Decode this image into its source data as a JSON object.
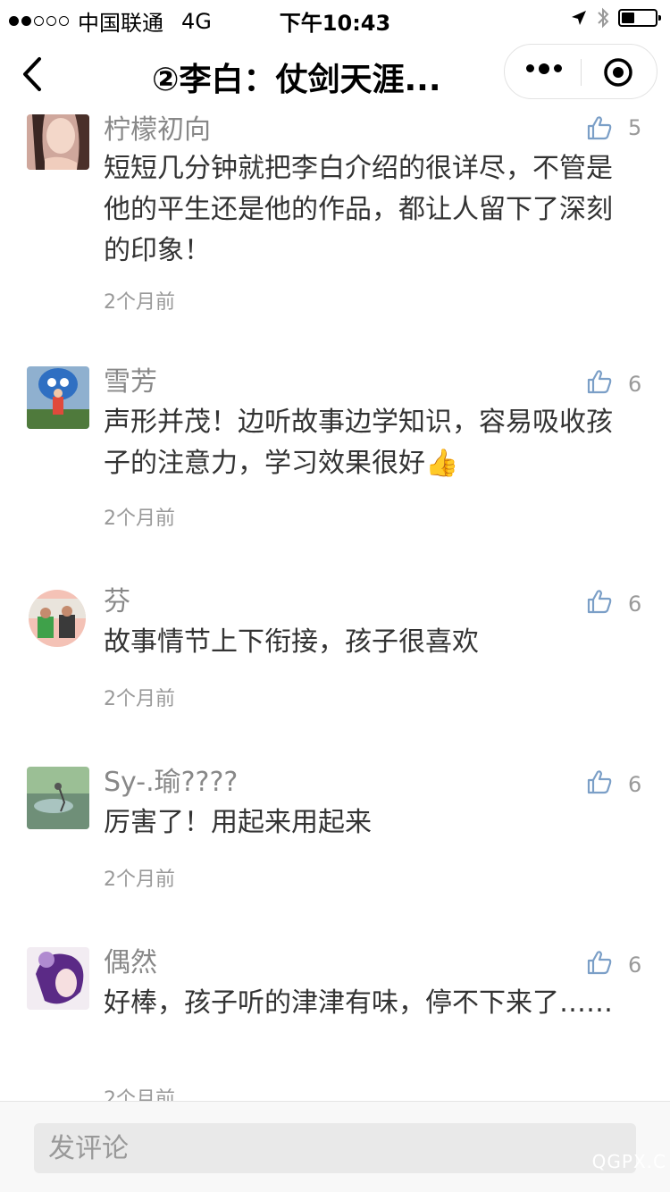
{
  "status": {
    "carrier": "中国联通",
    "network": "4G",
    "time": "下午10:43"
  },
  "nav": {
    "title": "②李白：仗剑天涯..."
  },
  "comments": [
    {
      "name": "柠檬初向",
      "text": "短短几分钟就把李白介绍的很详尽，不管是他的平生还是他的作品，都让人留下了深刻的印象！",
      "time": "2个月前",
      "likes": "5"
    },
    {
      "name": "雪芳",
      "text": "声形并茂！边听故事边学知识，容易吸收孩子的注意力，学习效果很好👍",
      "time": "2个月前",
      "likes": "6"
    },
    {
      "name": "芬",
      "text": "故事情节上下衔接，孩子很喜欢",
      "time": "2个月前",
      "likes": "6"
    },
    {
      "name": "Sy-.瑜????",
      "text": "厉害了！用起来用起来",
      "time": "2个月前",
      "likes": "6"
    },
    {
      "name": "偶然",
      "text": "好棒，孩子听的津津有味，停不下来了……",
      "time": "2个月前",
      "likes": "6"
    }
  ],
  "bottom": {
    "placeholder": "发评论"
  },
  "watermark": "QGPX.C",
  "colors": {
    "like_icon": "#7b9fc7",
    "meta_text": "#999999",
    "input_bg": "#e9e9e9"
  }
}
